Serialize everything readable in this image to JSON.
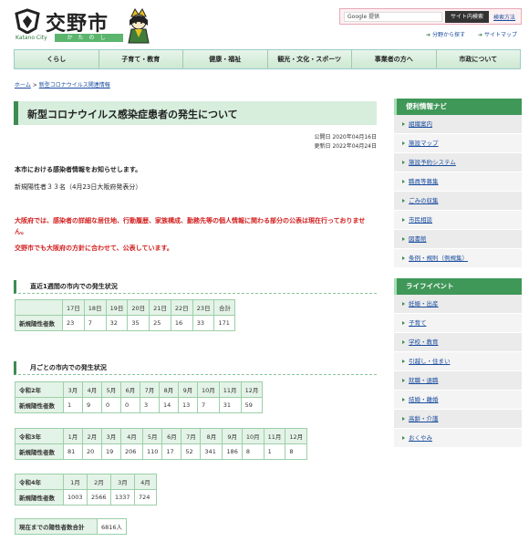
{
  "header": {
    "logo_title": "交野市",
    "logo_en": "Katano City",
    "logo_kana": "かたのし",
    "search_placeholder": "Google 提供",
    "search_button": "サイト内検索",
    "search_help": "検索方法",
    "links": [
      "分野から探す",
      "サイトマップ"
    ]
  },
  "gnav": [
    "くらし",
    "子育て・教育",
    "健康・福祉",
    "観光・文化・スポーツ",
    "事業者の方へ",
    "市政について"
  ],
  "breadcrumb": {
    "home": "ホーム",
    "sep": ">",
    "current": "新型コロナウイルス関連情報"
  },
  "main": {
    "title": "新型コロナウイルス感染症患者の発生について",
    "published": "公開日 2020年04月16日",
    "updated": "更新日 2022年04月24日",
    "intro": "本市における感染者情報をお知らせします。",
    "new_cases": "新規陽性者３３名（4月23日大阪府発表分）",
    "notice1": "大阪府では、感染者の詳細な居住地、行動履歴、家族構成、勤務先等の個人情報に関わる部分の公表は現在行っておりません。",
    "notice2": "交野市でも大阪府の方針に合わせて、公表しています。",
    "weekly_heading": "直近1週間の市内での発生状況",
    "weekly": {
      "header": [
        "",
        "17日",
        "18日",
        "19日",
        "20日",
        "21日",
        "22日",
        "23日",
        "合計"
      ],
      "row_label": "新規陽性者数",
      "values": [
        "23",
        "7",
        "32",
        "35",
        "25",
        "16",
        "33",
        "171"
      ]
    },
    "monthly_heading": "月ごとの市内での発生状況",
    "r2": {
      "header": [
        "令和2年",
        "3月",
        "4月",
        "5月",
        "6月",
        "7月",
        "8月",
        "9月",
        "10月",
        "11月",
        "12月"
      ],
      "row_label": "新規陽性者数",
      "values": [
        "1",
        "9",
        "0",
        "0",
        "3",
        "14",
        "13",
        "7",
        "31",
        "59"
      ]
    },
    "r3": {
      "header": [
        "令和3年",
        "1月",
        "2月",
        "3月",
        "4月",
        "5月",
        "6月",
        "7月",
        "8月",
        "9月",
        "10月",
        "11月",
        "12月"
      ],
      "row_label": "新規陽性者数",
      "values": [
        "81",
        "20",
        "19",
        "206",
        "110",
        "17",
        "52",
        "341",
        "186",
        "8",
        "1",
        "8"
      ]
    },
    "r4": {
      "header": [
        "令和4年",
        "1月",
        "2月",
        "3月",
        "4月"
      ],
      "row_label": "新規陽性者数",
      "values": [
        "1003",
        "2566",
        "1337",
        "724"
      ]
    },
    "total": {
      "label": "現在までの陽性者数合計",
      "value": "6816人"
    }
  },
  "sidebar": {
    "nav_title": "便利情報ナビ",
    "nav_items": [
      "組織案内",
      "施設マップ",
      "施設予約システム",
      "職員等募集",
      "ごみの収集",
      "市民相談",
      "図書館",
      "条例・規則（例規集）"
    ],
    "life_title": "ライフイベント",
    "life_items": [
      "妊娠・出産",
      "子育て",
      "学校・教育",
      "引越し・住まい",
      "就職・退職",
      "結婚・離婚",
      "高齢・介護",
      "おくやみ"
    ]
  }
}
